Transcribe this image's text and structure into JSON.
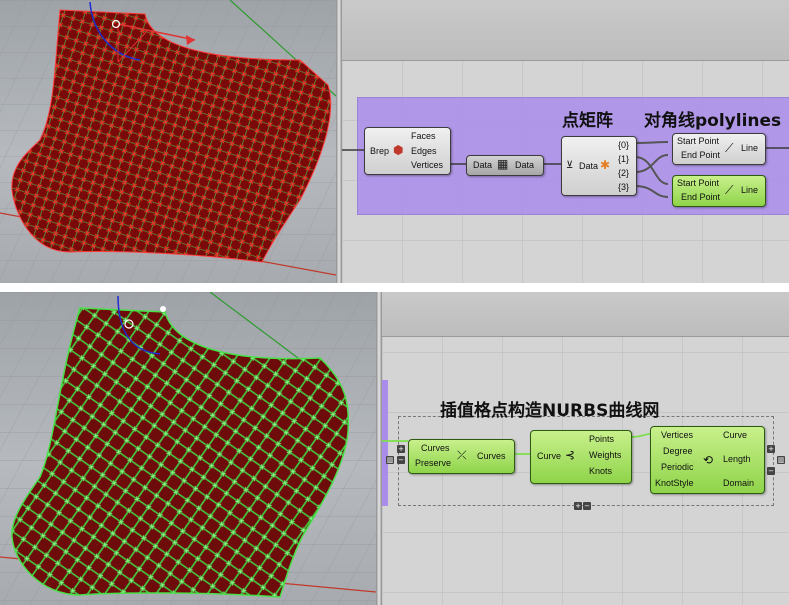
{
  "colors": {
    "surface_red": "#7a0a0a",
    "control_point_red": "#e02020",
    "curve_green": "#3ed03e",
    "group_purple": "#aa8ceb",
    "component_green": "#a6e060"
  },
  "top": {
    "group_title_a": "点矩阵",
    "group_title_b": "对角线polylines",
    "brep": {
      "input": "Brep",
      "outputs": [
        "Faces",
        "Edges",
        "Vertices"
      ],
      "icon": "brep-deconstruct-icon"
    },
    "data1": {
      "input": "Data",
      "output": "Data",
      "icon": "matrix-icon"
    },
    "explode": {
      "input": "Data",
      "outputs": [
        "{0}",
        "{1}",
        "{2}",
        "{3}"
      ],
      "icon": "tree-icon"
    },
    "line1": {
      "inputs": [
        "Start Point",
        "End Point"
      ],
      "output": "Line",
      "icon": "line-icon"
    },
    "line2": {
      "inputs": [
        "Start Point",
        "End Point"
      ],
      "output": "Line",
      "icon": "line-icon"
    }
  },
  "bottom": {
    "group_title": "插值格点构造NURBS曲线网",
    "flip": {
      "inputs": [
        "Curves",
        "Preserve"
      ],
      "output": "Curves",
      "icon": "flip-curve-icon"
    },
    "control": {
      "input": "Curve",
      "outputs": [
        "Points",
        "Weights",
        "Knots"
      ],
      "icon": "control-points-icon"
    },
    "nurbs": {
      "inputs": [
        "Vertices",
        "Degree",
        "Periodic",
        "KnotStyle"
      ],
      "outputs": [
        "Curve",
        "Length",
        "Domain"
      ],
      "icon": "nurbs-icon"
    }
  }
}
